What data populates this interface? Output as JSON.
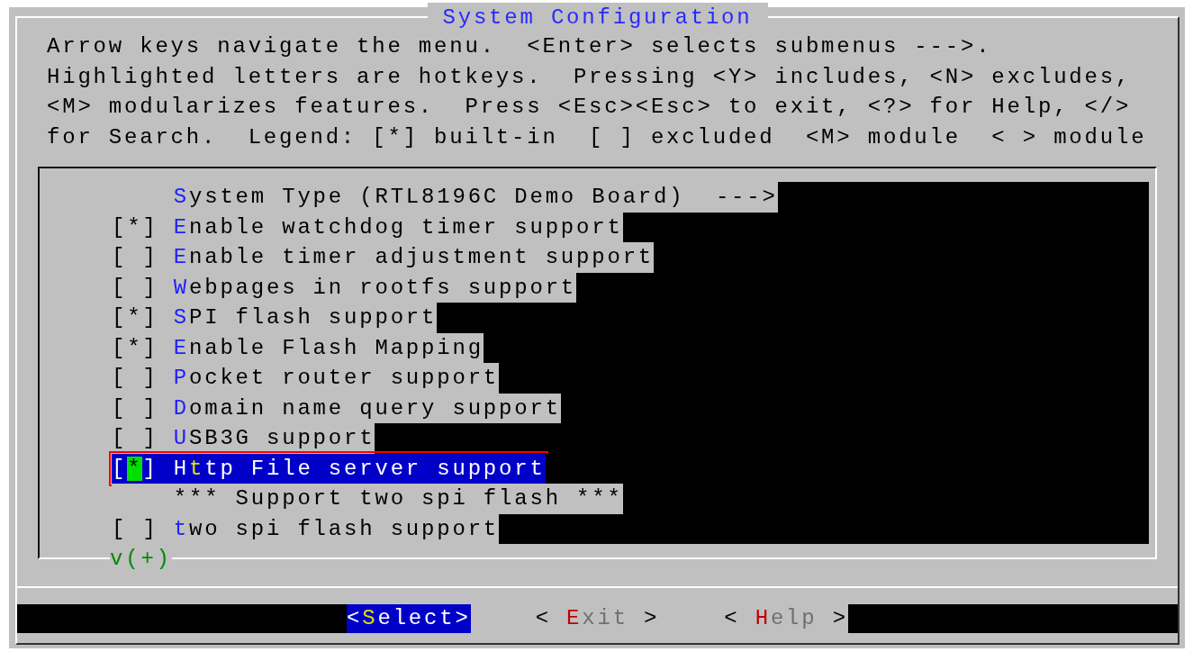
{
  "window": {
    "title": "System Configuration"
  },
  "help_lines": [
    "Arrow keys navigate the menu.  <Enter> selects submenus --->.",
    "Highlighted letters are hotkeys.  Pressing <Y> includes, <N> excludes,",
    "<M> modularizes features.  Press <Esc><Esc> to exit, <?> for Help, </>",
    "for Search.  Legend: [*] built-in  [ ] excluded  <M> module  < > module"
  ],
  "items": [
    {
      "kind": "menu",
      "hotkey": "S",
      "label_rest": "ystem Type (RTL8196C Demo Board)  --->",
      "selected": false
    },
    {
      "kind": "bool",
      "box": "[*]",
      "hotkey": "E",
      "label_rest": "nable watchdog timer support",
      "selected": false
    },
    {
      "kind": "bool",
      "box": "[ ]",
      "hotkey": "E",
      "label_rest": "nable timer adjustment support",
      "selected": false
    },
    {
      "kind": "bool",
      "box": "[ ]",
      "hotkey": "W",
      "label_rest": "ebpages in rootfs support",
      "selected": false
    },
    {
      "kind": "bool",
      "box": "[*]",
      "hotkey": "S",
      "label_rest": "PI flash support",
      "selected": false
    },
    {
      "kind": "bool",
      "box": "[*]",
      "hotkey": "E",
      "label_rest": "nable Flash Mapping",
      "selected": false
    },
    {
      "kind": "bool",
      "box": "[ ]",
      "hotkey": "P",
      "label_rest": "ocket router support",
      "selected": false
    },
    {
      "kind": "bool",
      "box": "[ ]",
      "hotkey": "D",
      "label_rest": "omain name query support",
      "selected": false
    },
    {
      "kind": "bool",
      "box": "[ ]",
      "hotkey": "U",
      "label_rest": "SB3G support",
      "selected": false
    },
    {
      "kind": "bool",
      "box": "[*]",
      "label_start": "H",
      "hotkey": "t",
      "label_rest": "tp File server support",
      "selected": true
    },
    {
      "kind": "comment",
      "label_rest": "*** Support two spi flash ***",
      "selected": false
    },
    {
      "kind": "bool",
      "box": "[ ]",
      "hotkey": "t",
      "label_rest": "wo spi flash support",
      "selected": false
    }
  ],
  "more_indicator": "v(+)",
  "buttons": [
    {
      "label_start": "<",
      "hotkey": "S",
      "label_rest": "elect>",
      "selected": true
    },
    {
      "label_start": "< ",
      "hotkey": "E",
      "label_rest": "xit >",
      "selected": false
    },
    {
      "label_start": "< ",
      "hotkey": "H",
      "label_rest": "elp >",
      "selected": false
    }
  ]
}
